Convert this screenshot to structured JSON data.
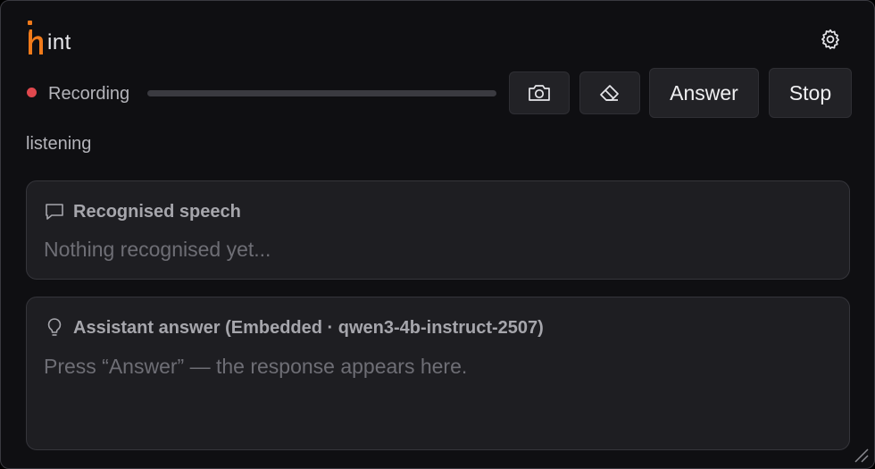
{
  "app": {
    "logo_text": "int",
    "accent_color": "#f07a1a"
  },
  "header": {
    "settings_icon": "gear-icon"
  },
  "recording": {
    "label": "Recording",
    "dot_color": "#e0484e",
    "level": 0.0
  },
  "toolbar": {
    "screenshot_icon": "camera-icon",
    "clear_icon": "eraser-icon",
    "answer_label": "Answer",
    "stop_label": "Stop"
  },
  "status": {
    "text": "listening"
  },
  "speech_panel": {
    "icon": "speech-bubble-icon",
    "title": "Recognised speech",
    "placeholder": "Nothing recognised yet..."
  },
  "answer_panel": {
    "icon": "lightbulb-icon",
    "title": "Assistant answer (Embedded · qwen3-4b-instruct-2507)",
    "placeholder": "Press “Answer” — the response appears here."
  }
}
